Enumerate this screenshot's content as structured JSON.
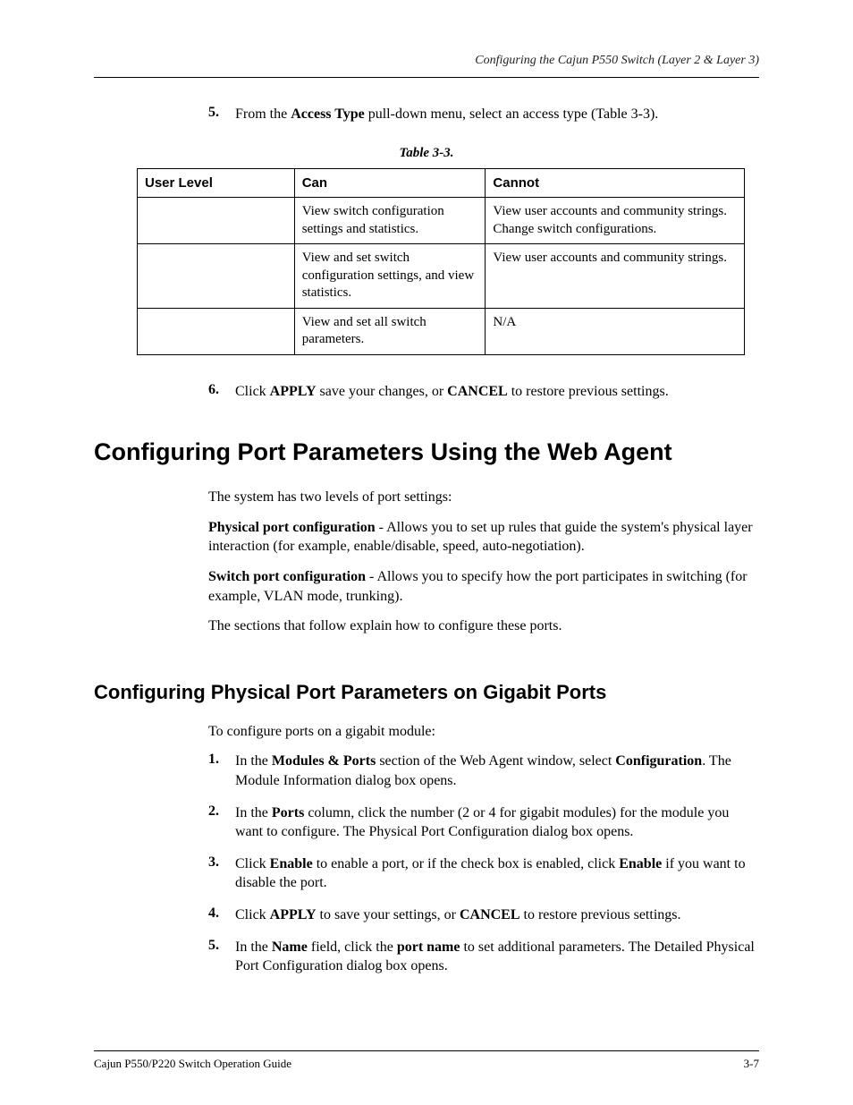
{
  "header": {
    "running": "Configuring the Cajun P550 Switch (Layer 2 & Layer 3)"
  },
  "step5": {
    "num": "5.",
    "pre": "From the ",
    "bold": "Access Type",
    "post": " pull-down menu, select an access type (Table 3-3)."
  },
  "table": {
    "caption": "Table 3-3.",
    "headers": {
      "level": "User Level",
      "can": "Can",
      "cannot": "Cannot"
    },
    "rows": [
      {
        "level": "",
        "can": "View switch configuration settings and statistics.",
        "cannot": "View user accounts and community strings. Change switch configurations."
      },
      {
        "level": "",
        "can": "View and set switch configuration settings, and view statistics.",
        "cannot": "View user accounts and community strings."
      },
      {
        "level": "",
        "can": "View and set all switch parameters.",
        "cannot": "N/A"
      }
    ]
  },
  "step6": {
    "num": "6.",
    "p1": "Click ",
    "b1": "APPLY",
    "p2": " save your changes, or ",
    "b2": "CANCEL",
    "p3": " to restore previous settings."
  },
  "h1": "Configuring Port Parameters Using the Web Agent",
  "intro": "The system has two levels of port settings:",
  "bullet1": {
    "b": "Physical port configuration",
    "t": " - Allows you to set up rules that guide the system's physical layer interaction (for example, enable/disable, speed, auto-negotiation)."
  },
  "bullet2": {
    "b": "Switch port configuration",
    "t": " - Allows you to specify how the port participates in switching (for example, VLAN mode, trunking)."
  },
  "followup": "The sections that follow explain how to configure these ports.",
  "h2": "Configuring Physical Port Parameters on Gigabit Ports",
  "gigabit_intro": "To configure ports on a gigabit module:",
  "steps": {
    "s1": {
      "n": "1.",
      "a": "In the ",
      "b1": "Modules & Ports",
      "c": " section of the Web Agent window, select ",
      "b2": "Configuration",
      "d": ". The Module Information dialog box opens."
    },
    "s2": {
      "n": "2.",
      "a": "In the ",
      "b1": "Ports",
      "c": " column, click the number (2 or 4 for gigabit modules) for the module you want to configure. The Physical Port Configuration dialog box opens."
    },
    "s3": {
      "n": "3.",
      "a": "Click ",
      "b1": "Enable",
      "c": " to enable a port, or if the check box is enabled, click ",
      "b2": "Enable",
      "d": " if you want to disable the port."
    },
    "s4": {
      "n": "4.",
      "a": "Click ",
      "b1": "APPLY",
      "c": " to save your settings, or ",
      "b2": "CANCEL",
      "d": " to restore previous settings."
    },
    "s5": {
      "n": "5.",
      "a": "In the ",
      "b1": "Name",
      "c": " field, click the ",
      "b2": "port name",
      "d": " to set additional parameters. The Detailed Physical Port Configuration dialog box opens."
    }
  },
  "footer": {
    "left": "Cajun P550/P220 Switch Operation Guide",
    "right": "3-7"
  }
}
